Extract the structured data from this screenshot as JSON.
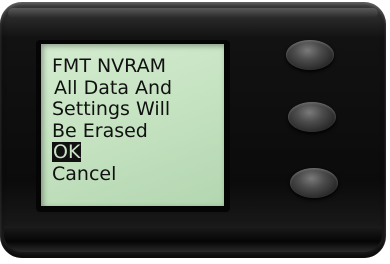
{
  "screen": {
    "title": "FMT NVRAM",
    "message_lines": [
      "All Data And",
      "Settings Will",
      "Be Erased"
    ],
    "options": {
      "selected": "OK",
      "other": "Cancel"
    }
  },
  "device": {
    "button_icons": [
      "hardware-button-top",
      "hardware-button-middle",
      "hardware-button-bottom"
    ],
    "colors": {
      "lcd_background": "#c3e1bf",
      "lcd_text": "#111111",
      "body": "#0b0b0b"
    }
  }
}
